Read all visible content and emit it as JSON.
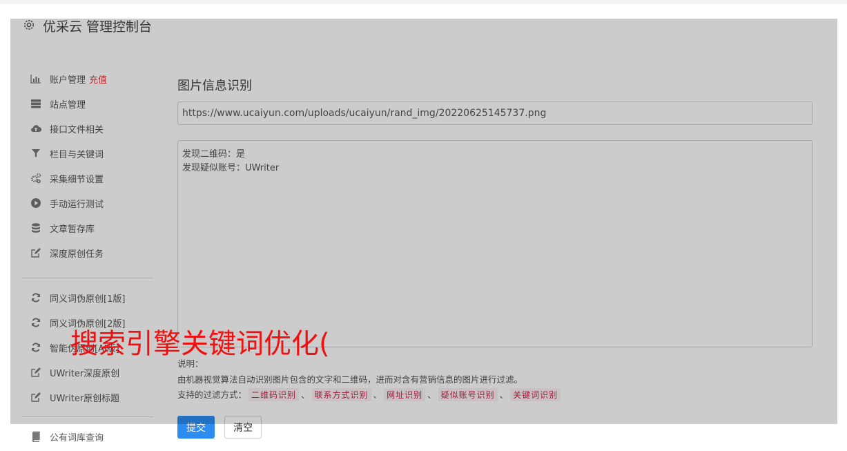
{
  "header": {
    "title": "优采云 管理控制台"
  },
  "sidebar": {
    "items": [
      {
        "label": "账户管理",
        "highlight": "充值",
        "icon": "bar-chart-icon"
      },
      {
        "label": "站点管理",
        "icon": "server-icon"
      },
      {
        "label": "接口文件相关",
        "icon": "cloud-upload-icon"
      },
      {
        "label": "栏目与关键词",
        "icon": "filter-icon"
      },
      {
        "label": "采集细节设置",
        "icon": "gears-icon"
      },
      {
        "label": "手动运行测试",
        "icon": "play-circle-icon"
      },
      {
        "label": "文章暂存库",
        "icon": "database-icon"
      },
      {
        "label": "深度原创任务",
        "icon": "edit-icon"
      },
      {
        "label": "同义词伪原创[1版]",
        "icon": "refresh-icon"
      },
      {
        "label": "同义词伪原创[2版]",
        "icon": "refresh-icon"
      },
      {
        "label": "智能伪原创[AI版]",
        "icon": "refresh-icon"
      },
      {
        "label": "UWriter深度原创",
        "icon": "edit-icon"
      },
      {
        "label": "UWriter原创标题",
        "icon": "edit-icon"
      },
      {
        "label": "公有词库查询",
        "icon": "book-icon"
      }
    ]
  },
  "main": {
    "title": "图片信息识别",
    "url_value": "https://www.ucaiyun.com/uploads/ucaiyun/rand_img/20220625145737.png",
    "result_lines": [
      "发现二维码：是",
      "发现疑似账号：UWriter"
    ],
    "notes": {
      "heading": "说明：",
      "description": "由机器视觉算法自动识别图片包含的文字和二维码，进而对含有营销信息的图片进行过滤。",
      "filter_prefix": "支持的过滤方式：",
      "filters": [
        "二维码识别",
        "联系方式识别",
        "网址识别",
        "疑似账号识别",
        "关键词识别"
      ],
      "separator": "、"
    },
    "submit_label": "提交",
    "clear_label": "清空"
  },
  "watermark": {
    "text": "搜索引擎关键词优化("
  },
  "colors": {
    "primary": "#2d8cf0",
    "highlight": "#e4393c",
    "chip_text": "#c7254e",
    "watermark": "#ee1111"
  }
}
